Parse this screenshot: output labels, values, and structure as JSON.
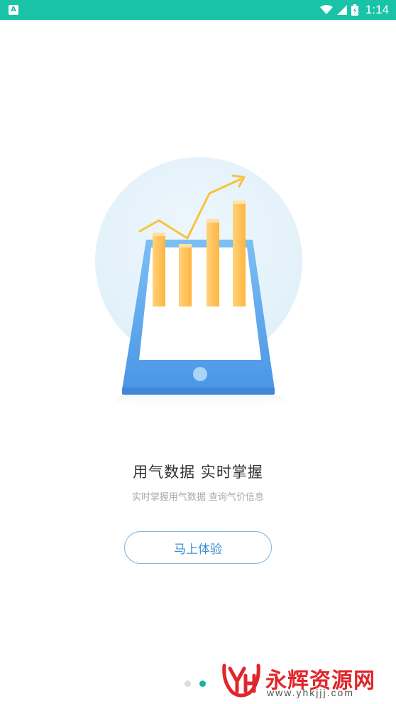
{
  "status_bar": {
    "app_icon_letter": "A",
    "time": "1:14",
    "icons": [
      "wifi-icon",
      "signal-icon",
      "battery-icon"
    ],
    "background_color": "#19c3a8"
  },
  "onboarding": {
    "title": "用气数据  实时掌握",
    "subtitle": "实时掌握用气数据  查询气价信息",
    "start_button_label": "马上体验",
    "illustration_icon": "tablet-bar-chart-illustration"
  },
  "pager": {
    "pages": 2,
    "active_index": 1,
    "inactive_color": "#dddddd",
    "active_color": "#19b3a0"
  },
  "watermark": {
    "logo_text": "YH",
    "name": "永辉资源网",
    "url": "www.yhkjjj.com"
  }
}
